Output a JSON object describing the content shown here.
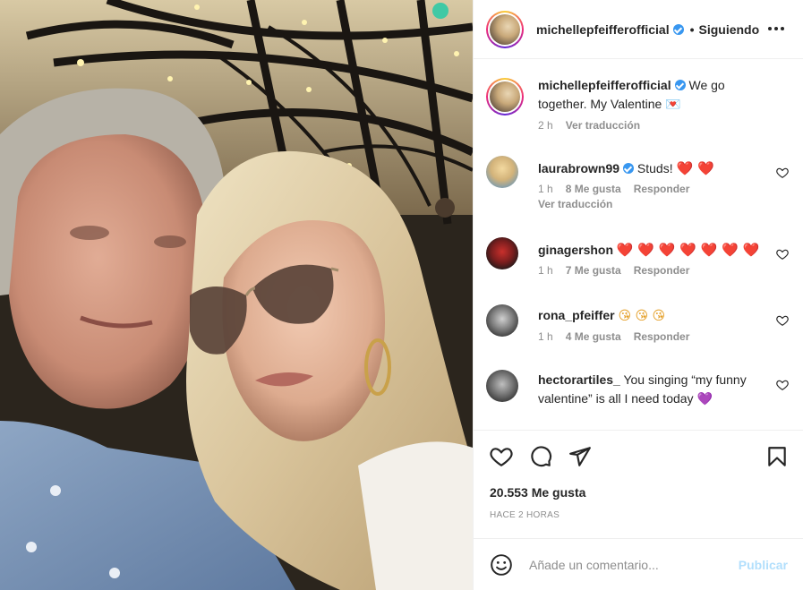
{
  "post": {
    "username": "michellepfeifferofficial",
    "follow_separator": "•",
    "follow_label": "Siguiendo",
    "caption": {
      "username": "michellepfeifferofficial",
      "text": "We go together. My Valentine",
      "emoji": "💌",
      "time": "2 h",
      "translate": "Ver traducción"
    }
  },
  "comments": [
    {
      "username": "laurabrown99",
      "verified": true,
      "text": "Studs!",
      "emoji": "❤️ ❤️",
      "time": "1 h",
      "likes": "8 Me gusta",
      "reply": "Responder",
      "translate": "Ver traducción"
    },
    {
      "username": "ginagershon",
      "verified": false,
      "text": "",
      "emoji": "❤️ ❤️ ❤️ ❤️ ❤️ ❤️ ❤️",
      "time": "1 h",
      "likes": "7 Me gusta",
      "reply": "Responder"
    },
    {
      "username": "rona_pfeiffer",
      "verified": false,
      "text": "",
      "emoji": "😘 😘 😘",
      "time": "1 h",
      "likes": "4 Me gusta",
      "reply": "Responder"
    },
    {
      "username": "hectorartiles_",
      "verified": false,
      "text": "You singing “my funny valentine” is all I need today",
      "emoji": "💜"
    }
  ],
  "actions": {
    "likes": "20.553 Me gusta",
    "time_ago": "HACE 2 HORAS",
    "comment_placeholder": "Añade un comentario...",
    "publish_label": "Publicar"
  },
  "icons": {
    "like": "heart-icon",
    "comment": "comment-icon",
    "share": "share-icon",
    "save": "bookmark-icon",
    "emoji": "emoji-icon",
    "more": "more-options-icon"
  },
  "colors": {
    "verified": "#3897f0",
    "publish_disabled": "#b2dffc",
    "muted_text": "#8e8e8e",
    "heart": "#ed2c3a"
  }
}
